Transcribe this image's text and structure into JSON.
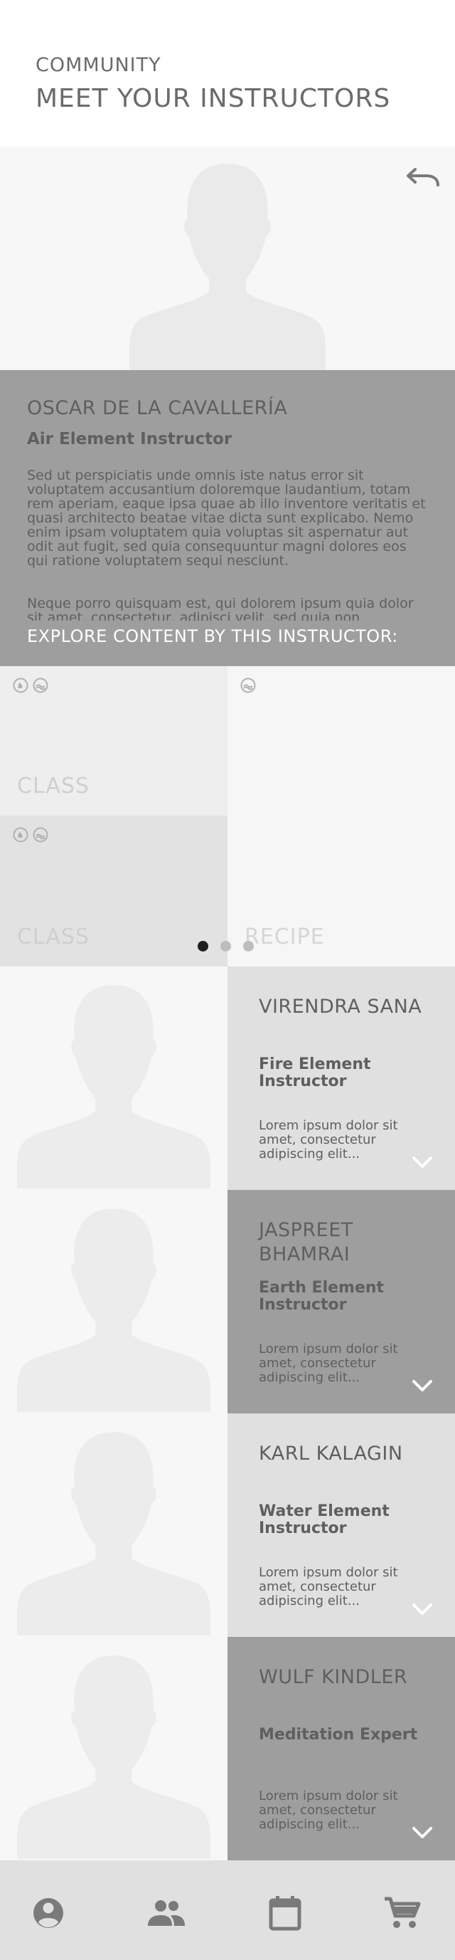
{
  "header": {
    "kicker": "COMMUNITY",
    "title": "MEET YOUR INSTRUCTORS"
  },
  "featured": {
    "name": "OSCAR DE LA CAVALLERÍA",
    "role": "Air Element Instructor",
    "bio_paragraph_1": "Sed ut perspiciatis unde omnis iste natus error sit voluptatem accusantium doloremque laudantium, totam rem aperiam, eaque ipsa quae ab illo inventore veritatis et quasi architecto beatae vitae dicta sunt explicabo. Nemo enim ipsam voluptatem quia voluptas sit aspernatur aut odit aut fugit, sed quia consequuntur magni dolores eos qui ratione voluptatem sequi nesciunt.",
    "bio_paragraph_2": "Neque porro quisquam est, qui dolorem ipsum quia dolor sit amet, consectetur, adipisci velit, sed quia non numquam eius modi tempora incidunt ut labore et dolore magnam aliquam quaerat voluptatem.",
    "explore_label": "EXPLORE CONTENT BY THIS INSTRUCTOR:",
    "back_icon": "undo-arrow-icon"
  },
  "content_tiles": [
    {
      "label": "CLASS",
      "icons": [
        "fire-element-icon",
        "water-element-icon"
      ]
    },
    {
      "label": "RECIPE",
      "icons": [
        "water-element-icon"
      ]
    },
    {
      "label": "CLASS",
      "icons": [
        "fire-element-icon",
        "water-element-icon"
      ]
    }
  ],
  "carousel": {
    "pages": 3,
    "active_page": 1
  },
  "instructors": [
    {
      "name": "VIRENDRA SANA",
      "role": "Fire Element Instructor",
      "description": "Lorem ipsum dolor sit amet, consectetur adipiscing elit...",
      "theme": "light"
    },
    {
      "name": "JASPREET BHAMRAI",
      "role": "Earth Element Instructor",
      "description": "Lorem ipsum dolor sit amet, consectetur adipiscing elit...",
      "theme": "dark"
    },
    {
      "name": "KARL KALAGIN",
      "role": "Water Element Instructor",
      "description": "Lorem ipsum dolor sit amet, consectetur adipiscing elit...",
      "theme": "light"
    },
    {
      "name": "WULF KINDLER",
      "role": "Meditation Expert",
      "description": "Lorem ipsum dolor sit amet, consectetur adipiscing elit...",
      "theme": "dark"
    }
  ],
  "bottom_nav": {
    "items": [
      "account-circle-icon",
      "people-icon",
      "calendar-icon",
      "cart-icon"
    ]
  },
  "colors": {
    "panel_dark": "#9e9e9e",
    "panel_light": "#e0e0e0",
    "text_dark": "#5f5f5f",
    "icon_gray": "#7a7a7a"
  }
}
